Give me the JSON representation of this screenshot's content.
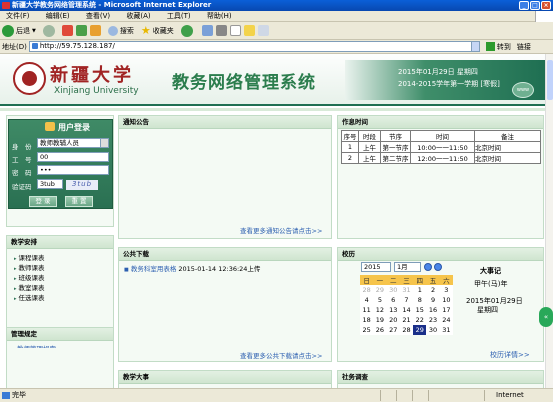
{
  "window": {
    "title": "新疆大学教务网络管理系统 - Microsoft Internet Explorer"
  },
  "menubar": [
    "文件(F)",
    "编辑(E)",
    "查看(V)",
    "收藏(A)",
    "工具(T)",
    "帮助(H)"
  ],
  "toolbar": {
    "back": "后退",
    "search": "搜索",
    "favorites": "收藏夹"
  },
  "address": {
    "label": "地址(D)",
    "url": "http://59.75.128.187/",
    "go": "转到",
    "links": "链接"
  },
  "header": {
    "uni_cn": "新疆大学",
    "uni_en": "Xinjiang University",
    "system_title": "教务网络管理系统",
    "date_line": "2015年01月29日 星期四",
    "term_line": "2014-2015学年第一学期 [寒假]",
    "www": "www"
  },
  "login": {
    "title": "用户登录",
    "role_label": "身　份",
    "role_value": "教师教辅人员",
    "id_label": "工　号",
    "id_value": "00",
    "pwd_label": "密　码",
    "pwd_value": "•••",
    "captcha_label": "验证码",
    "captcha_value": "3tub",
    "captcha_image": "3tub",
    "login_btn": "登 录",
    "reset_btn": "重 置"
  },
  "notice": {
    "title": "通知公告",
    "more": "查看更多通知公告请点击>>"
  },
  "schedule": {
    "title": "作息时间",
    "headers": [
      "序号",
      "时段",
      "节序",
      "时间",
      "备注"
    ],
    "rows": [
      [
        "1",
        "上午",
        "第一节序",
        "10:00一一11:50",
        "北京时间"
      ],
      [
        "2",
        "上午",
        "第二节序",
        "12:00一一11:50",
        "北京时间"
      ]
    ]
  },
  "teaching": {
    "title": "教学安排",
    "items": [
      "课程课表",
      "教师课表",
      "班级课表",
      "教室课表",
      "任选课表"
    ]
  },
  "downloads": {
    "title": "公共下载",
    "item_name": "教务科室用表格",
    "item_date": "2015-01-14 12:36:24上传",
    "more": "查看更多公共下载请点击>>"
  },
  "calendar": {
    "title": "校历",
    "year": "2015",
    "month": "1月",
    "weekdays": [
      "日",
      "一",
      "二",
      "三",
      "四",
      "五",
      "六"
    ],
    "weeks": [
      [
        "28",
        "29",
        "30",
        "31",
        "1",
        "2",
        "3"
      ],
      [
        "4",
        "5",
        "6",
        "7",
        "8",
        "9",
        "10"
      ],
      [
        "11",
        "12",
        "13",
        "14",
        "15",
        "16",
        "17"
      ],
      [
        "18",
        "19",
        "20",
        "21",
        "22",
        "23",
        "24"
      ],
      [
        "25",
        "26",
        "27",
        "28",
        "29",
        "30",
        "31"
      ]
    ],
    "today": "29",
    "events_title": "大事记",
    "lunar": "甲午(马)年",
    "event_date": "2015年01月29日",
    "event_weekday": "星期四",
    "detail": "校历详情>>"
  },
  "bottom": {
    "mgmt_title": "管理规定",
    "mgmt_item": "教师管理规定",
    "p2_title": "教学大事",
    "p3_title": "社务调查"
  },
  "status": {
    "text": "完毕",
    "zone": "Internet"
  }
}
